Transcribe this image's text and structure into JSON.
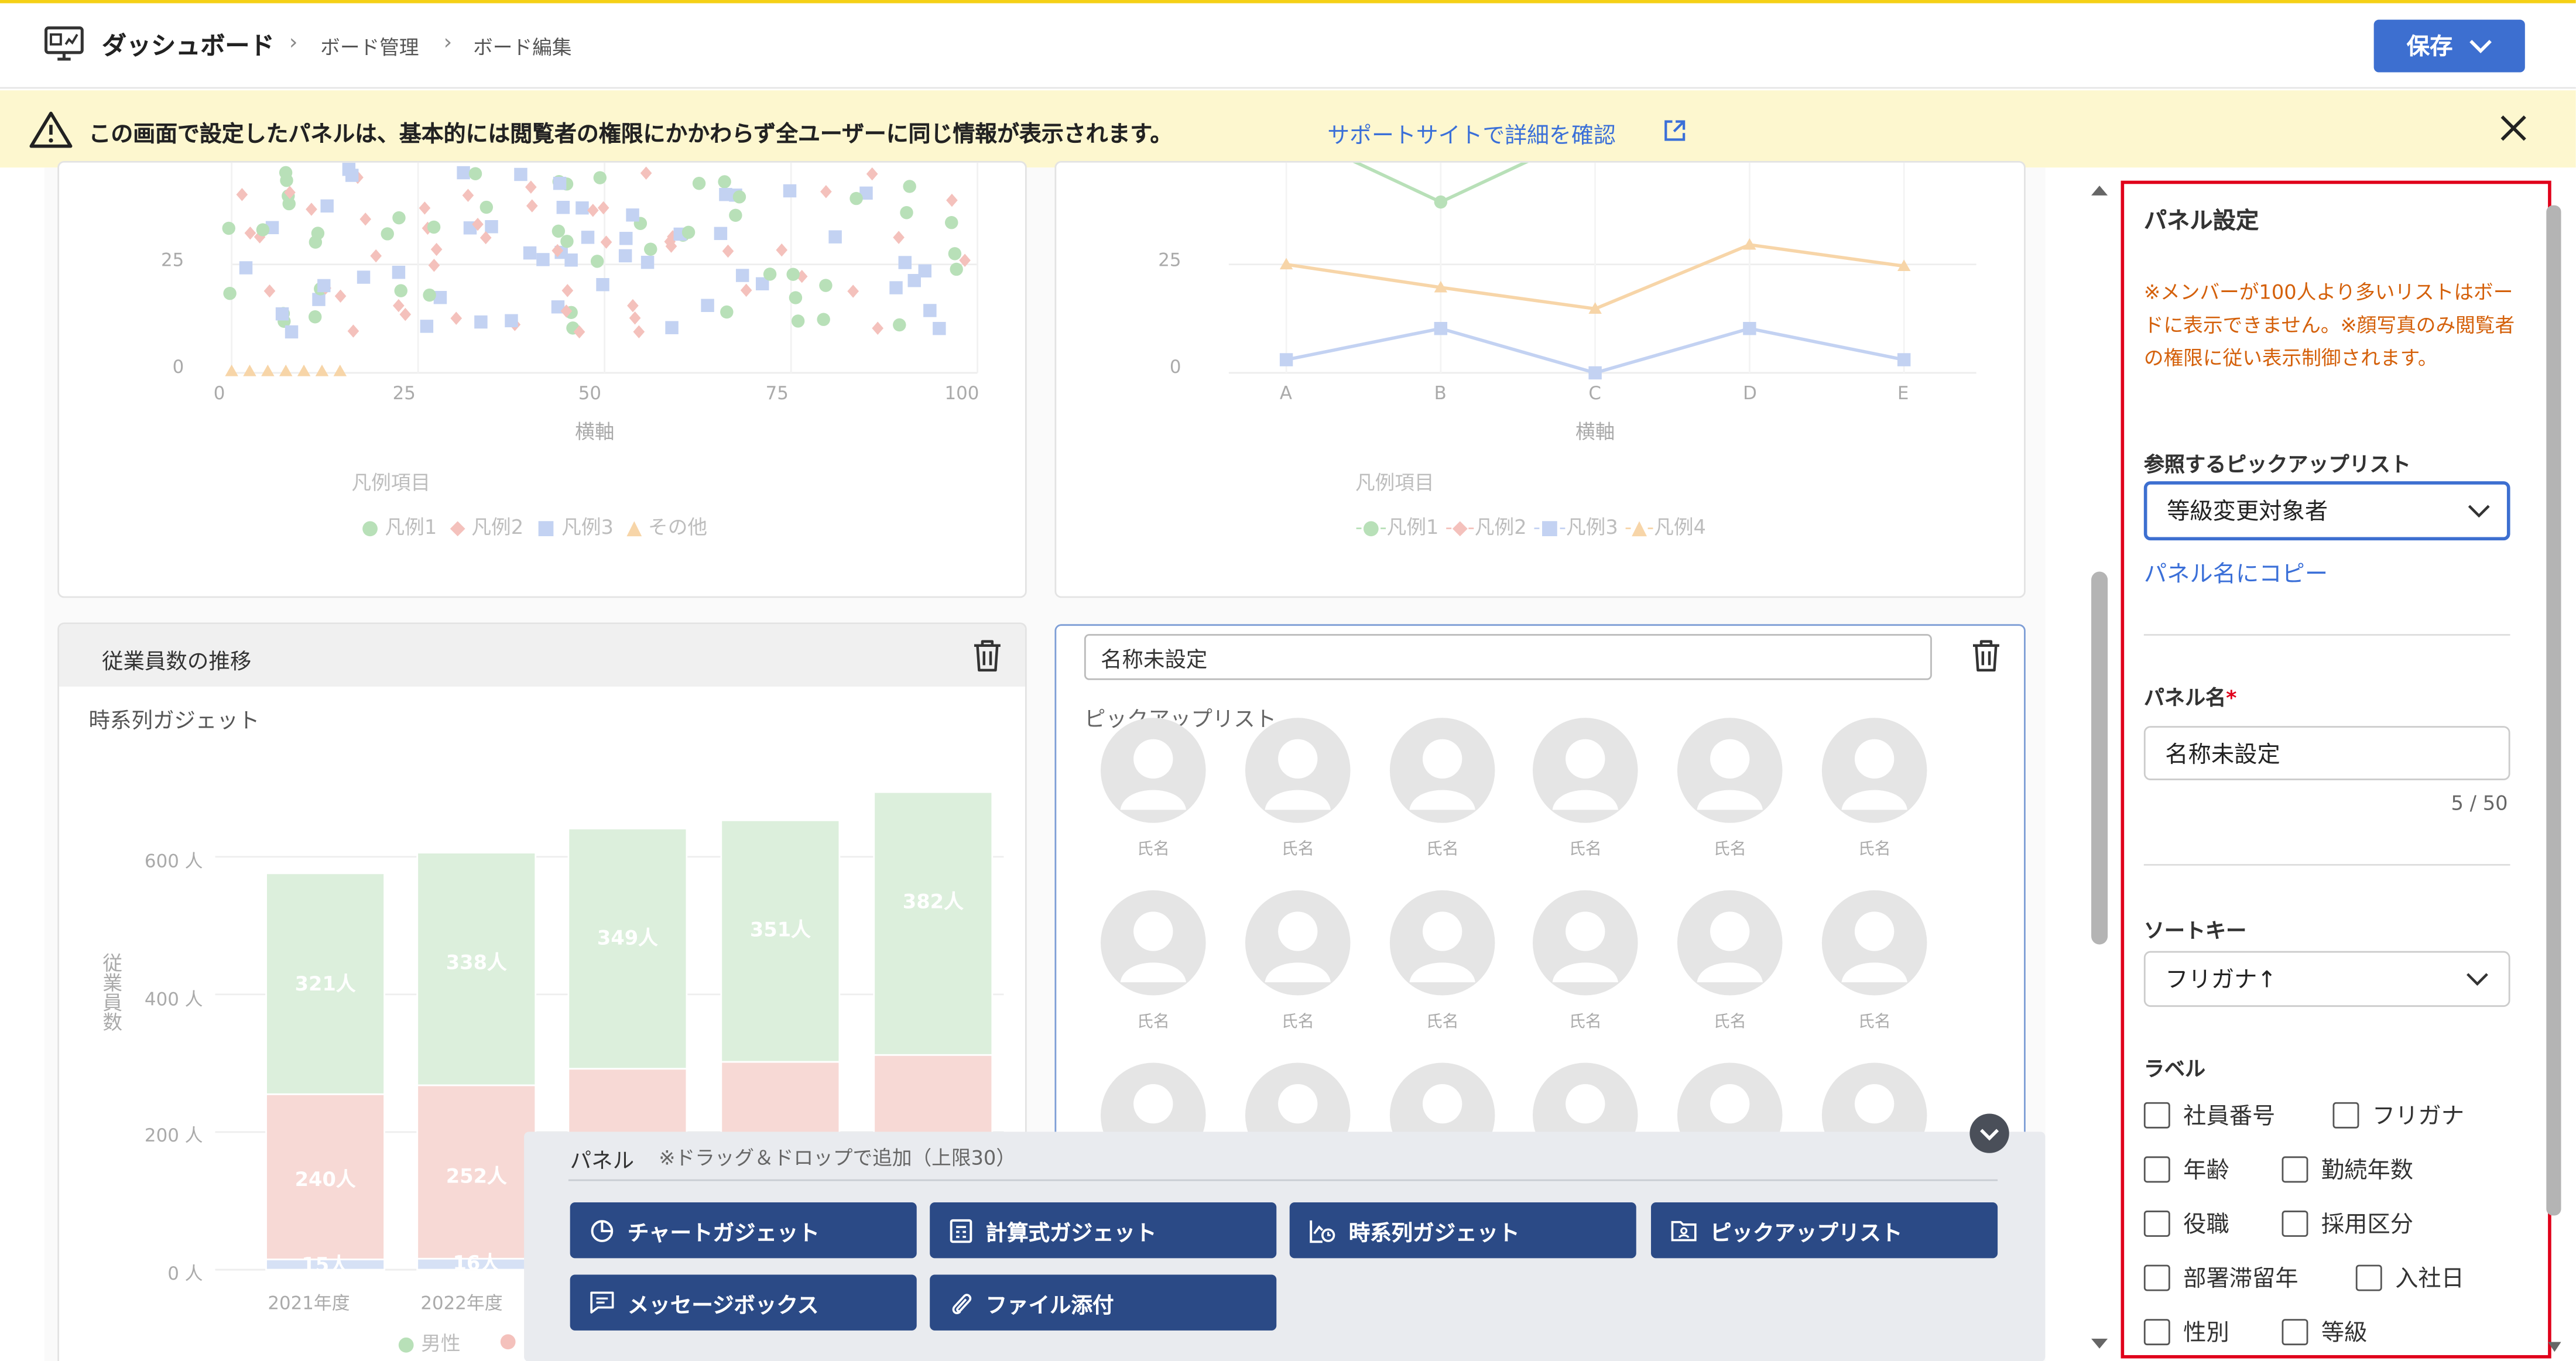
{
  "header": {
    "title": "ダッシュボード",
    "breadcrumbs": [
      "ボード管理",
      "ボード編集"
    ],
    "save_label": "保存"
  },
  "notice": {
    "text": "この画面で設定したパネルは、基本的には閲覧者の権限にかかわらず全ユーザーに同じ情報が表示されます。",
    "link": "サポートサイトで詳細を確認"
  },
  "scatter_chart": {
    "y_ticks": [
      "25",
      "0"
    ],
    "x_ticks": [
      "0",
      "25",
      "50",
      "75",
      "100"
    ],
    "xlabel": "横軸",
    "legend_title": "凡例項目",
    "legend": [
      "凡例1",
      "凡例2",
      "凡例3",
      "その他"
    ]
  },
  "line_chart": {
    "y_ticks": [
      "25",
      "0"
    ],
    "x_ticks": [
      "A",
      "B",
      "C",
      "D",
      "E"
    ],
    "xlabel": "横軸",
    "legend_title": "凡例項目",
    "legend": [
      "凡例1",
      "凡例2",
      "凡例3",
      "凡例4"
    ]
  },
  "timeseries_panel": {
    "title": "従業員数の推移",
    "gadget_label": "時系列ガジェット",
    "ylabel": "従業員数",
    "y_ticks": [
      "600 人",
      "400 人",
      "200 人",
      "0 人"
    ],
    "x_ticks": [
      "2021年度",
      "2022年度"
    ],
    "legend": [
      "男性"
    ]
  },
  "pickup_panel": {
    "name_value": "名称未設定",
    "gadget_label": "ピックアップリスト",
    "avatar_name": "氏名"
  },
  "chart_data": {
    "type": "bar",
    "categories": [
      "2021年度",
      "2022年度",
      "",
      "",
      ""
    ],
    "series": [
      {
        "name": "男性",
        "values": [
          321,
          338,
          349,
          351,
          382
        ]
      },
      {
        "values": [
          240,
          252,
          280,
          290,
          300
        ]
      },
      {
        "values": [
          15,
          16,
          12,
          12,
          12
        ]
      }
    ],
    "ylabel": "従業員数",
    "ylim": [
      0,
      700
    ]
  },
  "palette": {
    "title": "パネル",
    "hint": "※ドラッグ＆ドロップで追加（上限30）",
    "buttons": [
      "チャートガジェット",
      "計算式ガジェット",
      "時系列ガジェット",
      "ピックアップリスト",
      "メッセージボックス",
      "ファイル添付"
    ]
  },
  "panel_settings": {
    "title": "パネル設定",
    "warning": "※メンバーが100人より多いリストはボードに表示できません。※顔写真のみ閲覧者の権限に従い表示制御されます。",
    "list_label": "参照するピックアップリスト",
    "list_value": "等級変更対象者",
    "copy_link": "パネル名にコピー",
    "name_label": "パネル名",
    "required_mark": "*",
    "name_value": "名称未設定",
    "char_count": "5 / 50",
    "sort_label": "ソートキー",
    "sort_value": "フリガナ↑",
    "label_label": "ラベル",
    "checkboxes": [
      "社員番号",
      "フリガナ",
      "年齢",
      "勤続年数",
      "役職",
      "採用区分",
      "部署滞留年",
      "入社日",
      "性別",
      "等級"
    ]
  },
  "colors": {
    "accent": "#3d6fd0",
    "navy_button": "#2b4a86",
    "highlight_border": "#e0001a",
    "warning_text": "#d4600a",
    "notice_bg": "#fdf7cf"
  }
}
